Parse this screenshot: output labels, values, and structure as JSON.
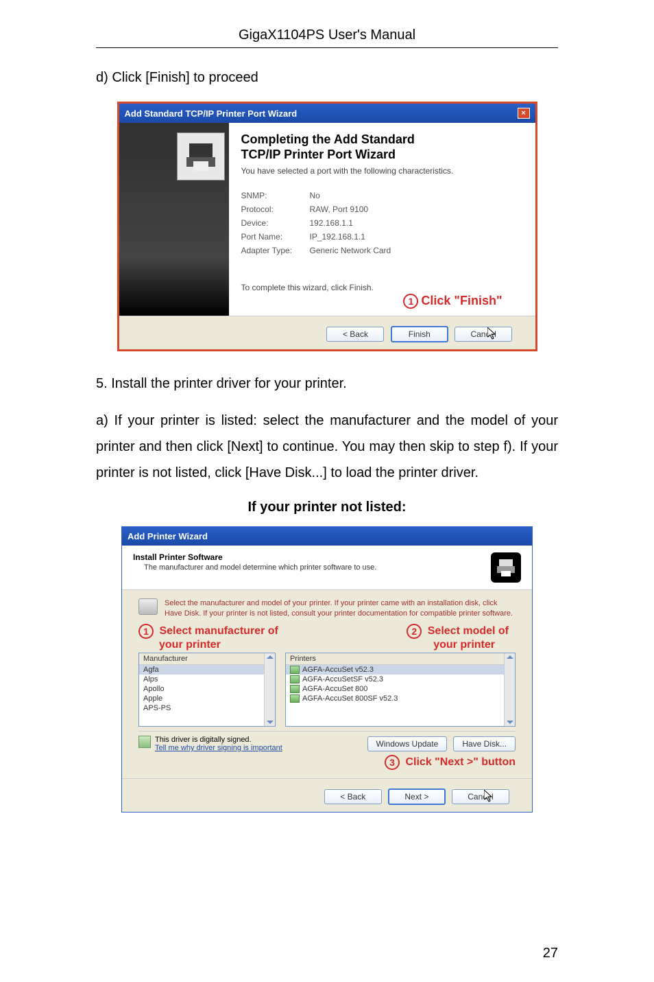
{
  "header": "GigaX1104PS User's Manual",
  "text_d": "d) Click [Finish] to proceed",
  "text_5": "5. Install the printer driver for your printer.",
  "text_a": "a) If your printer is listed: select the manufacturer and the model of your printer and then click [Next] to continue. You may then skip to step f). If your printer is not listed, click [Have Disk...] to load the printer driver.",
  "text_if": "If your printer not listed:",
  "page_num": "27",
  "dlg1": {
    "title": "Add Standard TCP/IP Printer Port Wizard",
    "h1a": "Completing the Add Standard",
    "h1b": "TCP/IP Printer Port Wizard",
    "sub": "You have selected a port with the following characteristics.",
    "kv": [
      {
        "k": "SNMP:",
        "v": "No"
      },
      {
        "k": "Protocol:",
        "v": "RAW, Port 9100"
      },
      {
        "k": "Device:",
        "v": "192.168.1.1"
      },
      {
        "k": "Port Name:",
        "v": "IP_192.168.1.1"
      },
      {
        "k": "Adapter Type:",
        "v": "Generic Network Card"
      }
    ],
    "bottom": "To complete this wizard, click Finish.",
    "anno1_num": "1",
    "anno1_txt": "Click \"Finish\"",
    "btn_back": "< Back",
    "btn_finish": "Finish",
    "btn_cancel": "Cancel"
  },
  "dlg2": {
    "title": "Add Printer Wizard",
    "head_h": "Install Printer Software",
    "head_s": "The manufacturer and model determine which printer software to use.",
    "instr": "Select the manufacturer and model of your printer. If your printer came with an installation disk, click Have Disk. If your printer is not listed, consult your printer documentation for compatible printer software.",
    "anno1_num": "1",
    "anno1_txt": "Select manufacturer of",
    "anno2_num": "2",
    "anno2_txt": "Select model of",
    "anno_sub": "your printer",
    "left_h": "Manufacturer",
    "left_items": [
      "Agfa",
      "Alps",
      "Apollo",
      "Apple",
      "APS-PS"
    ],
    "right_h": "Printers",
    "right_items": [
      "AGFA-AccuSet v52.3",
      "AGFA-AccuSetSF v52.3",
      "AGFA-AccuSet 800",
      "AGFA-AccuSet 800SF v52.3"
    ],
    "signed_txt": "This driver is digitally signed.",
    "signed_link": "Tell me why driver signing is important",
    "btn_wu": "Windows Update",
    "btn_hd": "Have Disk...",
    "anno3_num": "3",
    "anno3_txt": "Click \"Next >\" button",
    "btn_back": "< Back",
    "btn_next": "Next >",
    "btn_cancel": "Cancel"
  }
}
